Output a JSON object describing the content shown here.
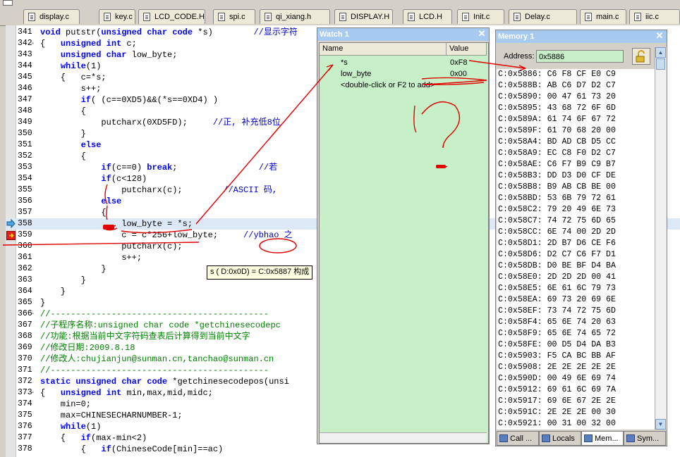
{
  "tabs": [
    {
      "label": "display.c"
    },
    {
      "label": "key.c"
    },
    {
      "label": "LCD_CODE.H"
    },
    {
      "label": "spi.c"
    },
    {
      "label": "qi_xiang.h"
    },
    {
      "label": "DISPLAY.H"
    },
    {
      "label": "LCD.H"
    },
    {
      "label": "Init.c"
    },
    {
      "label": "Delay.c"
    },
    {
      "label": "main.c"
    },
    {
      "label": "iic.c"
    }
  ],
  "code": [
    {
      "n": "341",
      "t": "void putstr(unsigned char code *s)        //显示字符"
    },
    {
      "n": "342",
      "t": "{   unsigned int c;"
    },
    {
      "n": "343",
      "t": "    unsigned char low_byte;"
    },
    {
      "n": "344",
      "t": "    while(1)"
    },
    {
      "n": "345",
      "t": "    {   c=*s;"
    },
    {
      "n": "346",
      "t": "        s++;"
    },
    {
      "n": "347",
      "t": "        if( (c==0XD5)&&(*s==0XD4) )"
    },
    {
      "n": "348",
      "t": "        {"
    },
    {
      "n": "349",
      "t": "            putcharx(0XD5FD);     //正, 补充低8位"
    },
    {
      "n": "350",
      "t": "        }"
    },
    {
      "n": "351",
      "t": "        else"
    },
    {
      "n": "352",
      "t": "        {"
    },
    {
      "n": "353",
      "t": "            if(c==0) break;                //若"
    },
    {
      "n": "354",
      "t": "            if(c<128)"
    },
    {
      "n": "355",
      "t": "                putcharx(c);        //ASCII 码,"
    },
    {
      "n": "356",
      "t": "            else"
    },
    {
      "n": "357",
      "t": "            {"
    },
    {
      "n": "358",
      "t": "                low_byte = *s;"
    },
    {
      "n": "359",
      "t": "                c = c*256+low_byte;     //ybhao 之"
    },
    {
      "n": "360",
      "t": "                putcharx(c);"
    },
    {
      "n": "361",
      "t": "                s++;"
    },
    {
      "n": "362",
      "t": "            }"
    },
    {
      "n": "363",
      "t": "        }"
    },
    {
      "n": "364",
      "t": "    }"
    },
    {
      "n": "365",
      "t": "}"
    },
    {
      "n": "366",
      "t": "//-------------------------------------------"
    },
    {
      "n": "367",
      "t": "//子程序名称:unsigned char code *getchinesecodepc"
    },
    {
      "n": "368",
      "t": "//功能:根据当前中文字符码查表后计算得到当前中文字"
    },
    {
      "n": "369",
      "t": "//修改日期:2009.8.18"
    },
    {
      "n": "370",
      "t": "//修改人:chujianjun@sunman.cn,tanchao@sunman.cn"
    },
    {
      "n": "371",
      "t": "//-------------------------------------------"
    },
    {
      "n": "372",
      "t": "static unsigned char code *getchinesecodepos(unsi"
    },
    {
      "n": "373",
      "t": "{   unsigned int min,max,mid,midc;"
    },
    {
      "n": "374",
      "t": "    min=0;"
    },
    {
      "n": "375",
      "t": "    max=CHINESECHARNUMBER-1;"
    },
    {
      "n": "376",
      "t": "    while(1)"
    },
    {
      "n": "377",
      "t": "    {   if(max-min<2)"
    },
    {
      "n": "378",
      "t": "        {   if(ChineseCode[min]==ac)"
    }
  ],
  "tooltip": {
    "prefix": "s ( D:0x0D) = ",
    "value": "C:0x5887",
    "suffix": " 构成"
  },
  "watch": {
    "title": "Watch 1",
    "col_name": "Name",
    "col_value": "Value",
    "rows": [
      {
        "name": "*s",
        "value": "0xF8"
      },
      {
        "name": "low_byte",
        "value": "0x00"
      },
      {
        "name": "<double-click or F2 to add>",
        "value": ""
      }
    ]
  },
  "memory": {
    "title": "Memory 1",
    "address_label": "Address:",
    "address": "0x5886",
    "rows": [
      "C:0x5886: C6 F8 CF E0 C9",
      "C:0x588B: AB C6 D7 D2 C7",
      "C:0x5890: 00 47 61 73 20",
      "C:0x5895: 43 68 72 6F 6D",
      "C:0x589A: 61 74 6F 67 72",
      "C:0x589F: 61 70 68 20 00",
      "C:0x58A4: BD AD CB D5 CC",
      "C:0x58A9: EC C8 F0 D2 C7",
      "C:0x58AE: C6 F7 B9 C9 B7",
      "C:0x58B3: DD D3 D0 CF DE",
      "C:0x58B8: B9 AB CB BE 00",
      "C:0x58BD: 53 6B 79 72 61",
      "C:0x58C2: 79 20 49 6E 73",
      "C:0x58C7: 74 72 75 6D 65",
      "C:0x58CC: 6E 74 00 2D 2D",
      "C:0x58D1: 2D B7 D6 CE F6",
      "C:0x58D6: D2 C7 C6 F7 D1",
      "C:0x58DB: D0 BE BF D4 BA",
      "C:0x58E0: 2D 2D 2D 00 41",
      "C:0x58E5: 6E 61 6C 79 73",
      "C:0x58EA: 69 73 20 69 6E",
      "C:0x58EF: 73 74 72 75 6D",
      "C:0x58F4: 65 6E 74 20 63",
      "C:0x58F9: 65 6E 74 65 72",
      "C:0x58FE: 00 D5 D4 DA B3",
      "C:0x5903: F5 CA BC BB AF",
      "C:0x5908: 2E 2E 2E 2E 2E",
      "C:0x590D: 00 49 6E 69 74",
      "C:0x5912: 69 61 6C 69 7A",
      "C:0x5917: 69 6E 67 2E 2E",
      "C:0x591C: 2E 2E 2E 00 30",
      "C:0x5921: 00 31 00 32 00"
    ]
  },
  "bottom_tabs": [
    {
      "label": "Call ..."
    },
    {
      "label": "Locals"
    },
    {
      "label": "Mem..."
    },
    {
      "label": "Sym..."
    }
  ]
}
